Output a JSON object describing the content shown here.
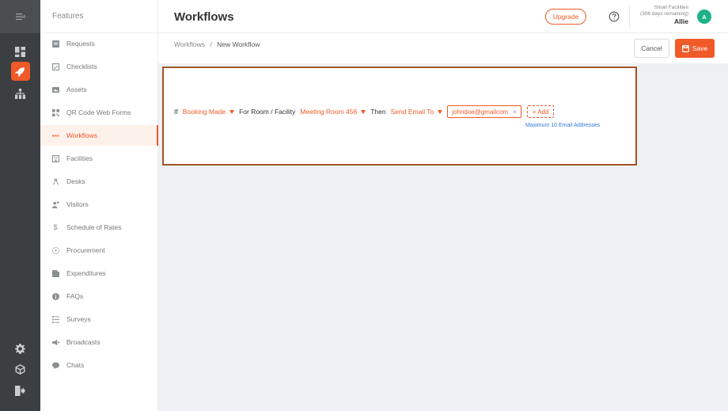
{
  "app": {
    "accent_color": "#f05a28"
  },
  "rail": {
    "top_icon": "menu-collapse-icon",
    "items": [
      {
        "icon": "dashboard-icon",
        "active": false
      },
      {
        "icon": "rocket-icon",
        "active": true
      },
      {
        "icon": "org-chart-icon",
        "active": false
      }
    ],
    "bottom_items": [
      {
        "icon": "gear-icon"
      },
      {
        "icon": "cube-icon"
      },
      {
        "icon": "logout-icon"
      }
    ]
  },
  "sidebar": {
    "title": "Features",
    "items": [
      {
        "label": "Requests",
        "icon": "clipboard-icon"
      },
      {
        "label": "Checklists",
        "icon": "checklist-icon"
      },
      {
        "label": "Assets",
        "icon": "assets-icon"
      },
      {
        "label": "QR Code Web Forms",
        "icon": "qr-code-icon"
      },
      {
        "label": "Workflows",
        "icon": "workflow-icon",
        "active": true
      },
      {
        "label": "Facilities",
        "icon": "building-icon"
      },
      {
        "label": "Desks",
        "icon": "desk-icon"
      },
      {
        "label": "Visitors",
        "icon": "visitors-icon"
      },
      {
        "label": "Schedule of Rates",
        "icon": "dollar-icon"
      },
      {
        "label": "Procurement",
        "icon": "procurement-icon"
      },
      {
        "label": "Expenditures",
        "icon": "wallet-icon"
      },
      {
        "label": "FAQs",
        "icon": "info-icon"
      },
      {
        "label": "Surveys",
        "icon": "survey-icon"
      },
      {
        "label": "Broadcasts",
        "icon": "megaphone-icon"
      },
      {
        "label": "Chats",
        "icon": "chat-icon"
      }
    ]
  },
  "header": {
    "title": "Workflows",
    "upgrade_label": "Upgrade",
    "account": {
      "plan": "Small Facilities",
      "days_remaining": "(306 days remaining)",
      "name": "Allie",
      "avatar_initial": "A"
    }
  },
  "subheader": {
    "breadcrumb_root": "Workflows",
    "breadcrumb_separator": "/",
    "breadcrumb_current": "New Workflow",
    "cancel_label": "Cancel",
    "save_label": "Save"
  },
  "workflow": {
    "if_word": "If",
    "trigger": "Booking Made",
    "for_word": "For Room / Facility",
    "room": "Meeting Room 456",
    "then_word": "Then",
    "action": "Send Email To",
    "emails": [
      "johndoe@gmailcom"
    ],
    "add_label": "+ Add",
    "max_note": "Maximum 10 Email Addresses"
  }
}
